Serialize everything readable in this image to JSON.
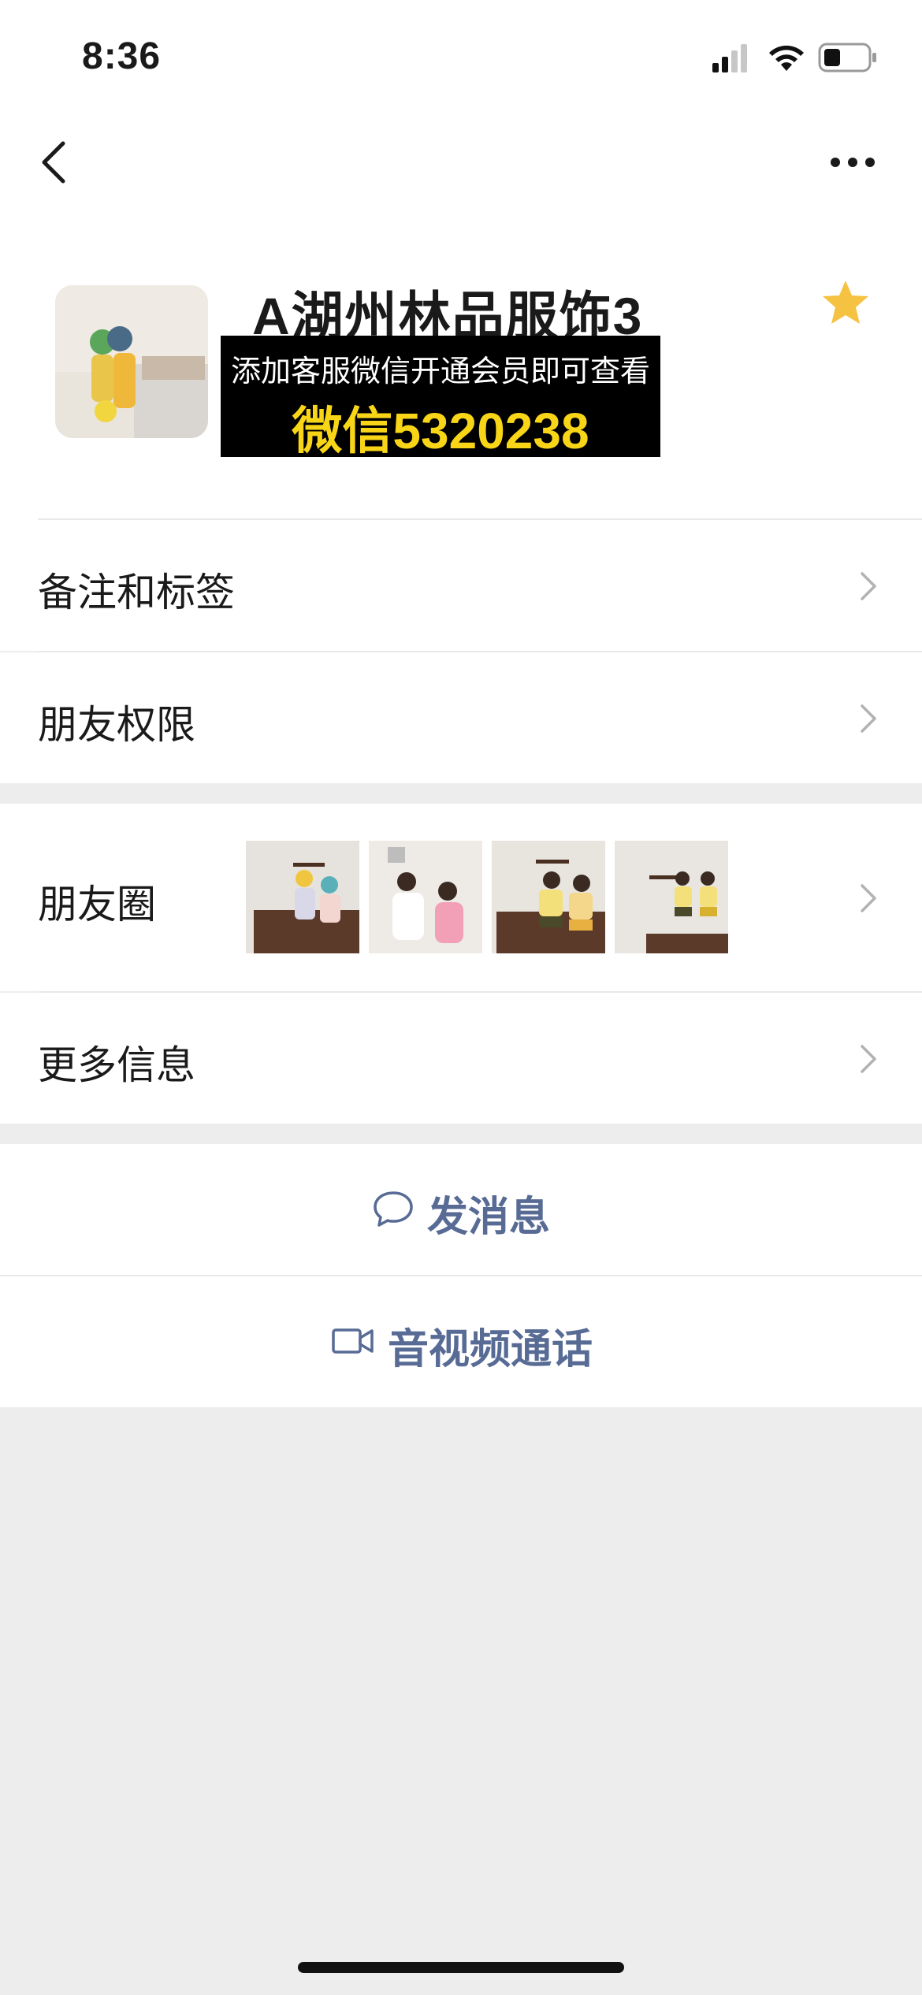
{
  "status_bar": {
    "time": "8:36",
    "icons": [
      "signal-icon",
      "wifi-icon",
      "battery-icon"
    ]
  },
  "nav": {
    "back_icon": "chevron-left-icon",
    "more_icon": "more-dots-icon"
  },
  "profile": {
    "name": "A湖州林品服饰3",
    "starred": true,
    "watermark": {
      "line1": "添加客服微信开通会员即可查看",
      "line2": "微信5320238"
    }
  },
  "rows": {
    "remarks": "备注和标签",
    "friend_permissions": "朋友权限",
    "moments": "朋友圈",
    "more_info": "更多信息"
  },
  "actions": {
    "send_message": "发消息",
    "video_call": "音视频通话"
  },
  "colors": {
    "accent_link": "#576b95",
    "star": "#f5c242",
    "watermark_text": "#f8d617",
    "background": "#ededed"
  }
}
